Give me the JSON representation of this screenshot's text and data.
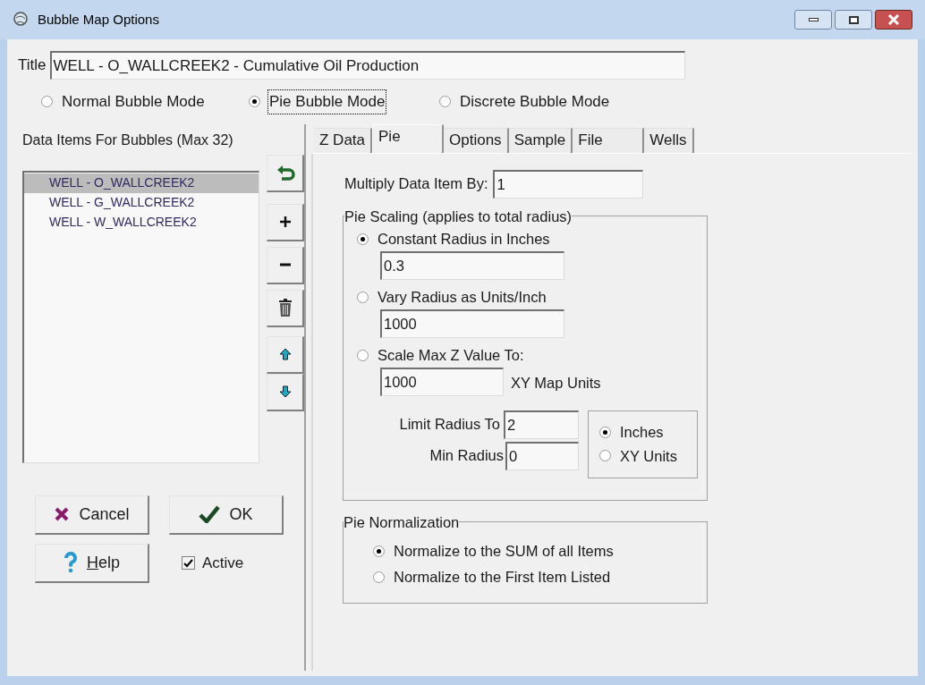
{
  "window": {
    "title": "Bubble Map Options"
  },
  "title_field": {
    "label": "Title",
    "value": "WELL - O_WALLCREEK2  - Cumulative Oil Production"
  },
  "modes": [
    {
      "label": "Normal Bubble Mode",
      "selected": false,
      "focused": false
    },
    {
      "label": "Pie Bubble Mode",
      "selected": true,
      "focused": true
    },
    {
      "label": "Discrete Bubble Mode",
      "selected": false,
      "focused": false
    }
  ],
  "data_items": {
    "heading": "Data Items For Bubbles (Max 32)",
    "items": [
      {
        "label": "WELL - O_WALLCREEK2",
        "selected": true
      },
      {
        "label": "WELL - G_WALLCREEK2",
        "selected": false
      },
      {
        "label": "WELL - W_WALLCREEK2",
        "selected": false
      }
    ]
  },
  "buttons": {
    "cancel": "Cancel",
    "ok": "OK",
    "help": "Help"
  },
  "active": {
    "label": "Active",
    "checked": true
  },
  "tabs": [
    {
      "label": "Z Data",
      "selected": false
    },
    {
      "label": "Pie",
      "selected": true
    },
    {
      "label": "Options",
      "selected": false
    },
    {
      "label": "Sample",
      "selected": false
    },
    {
      "label": "File",
      "selected": false
    },
    {
      "label": "Wells",
      "selected": false
    }
  ],
  "multiply": {
    "label": "Multiply Data Item By:",
    "value": "1"
  },
  "pie_scaling": {
    "title": "Pie Scaling (applies to total radius)",
    "options": [
      {
        "label": "Constant Radius in Inches",
        "selected": true,
        "value": "0.3"
      },
      {
        "label": "Vary Radius as Units/Inch",
        "selected": false,
        "value": "1000"
      },
      {
        "label": "Scale Max Z Value To:",
        "selected": false,
        "value": "1000",
        "suffix": "XY Map Units"
      }
    ],
    "limit_radius": {
      "label": "Limit Radius To",
      "value": "2"
    },
    "min_radius": {
      "label": "Min Radius",
      "value": "0"
    },
    "units": [
      {
        "label": "Inches",
        "selected": true
      },
      {
        "label": "XY Units",
        "selected": false
      }
    ]
  },
  "pie_normalization": {
    "title": "Pie Normalization",
    "options": [
      {
        "label": "Normalize to the SUM of all Items",
        "selected": true
      },
      {
        "label": "Normalize to the First Item Listed",
        "selected": false
      }
    ]
  }
}
